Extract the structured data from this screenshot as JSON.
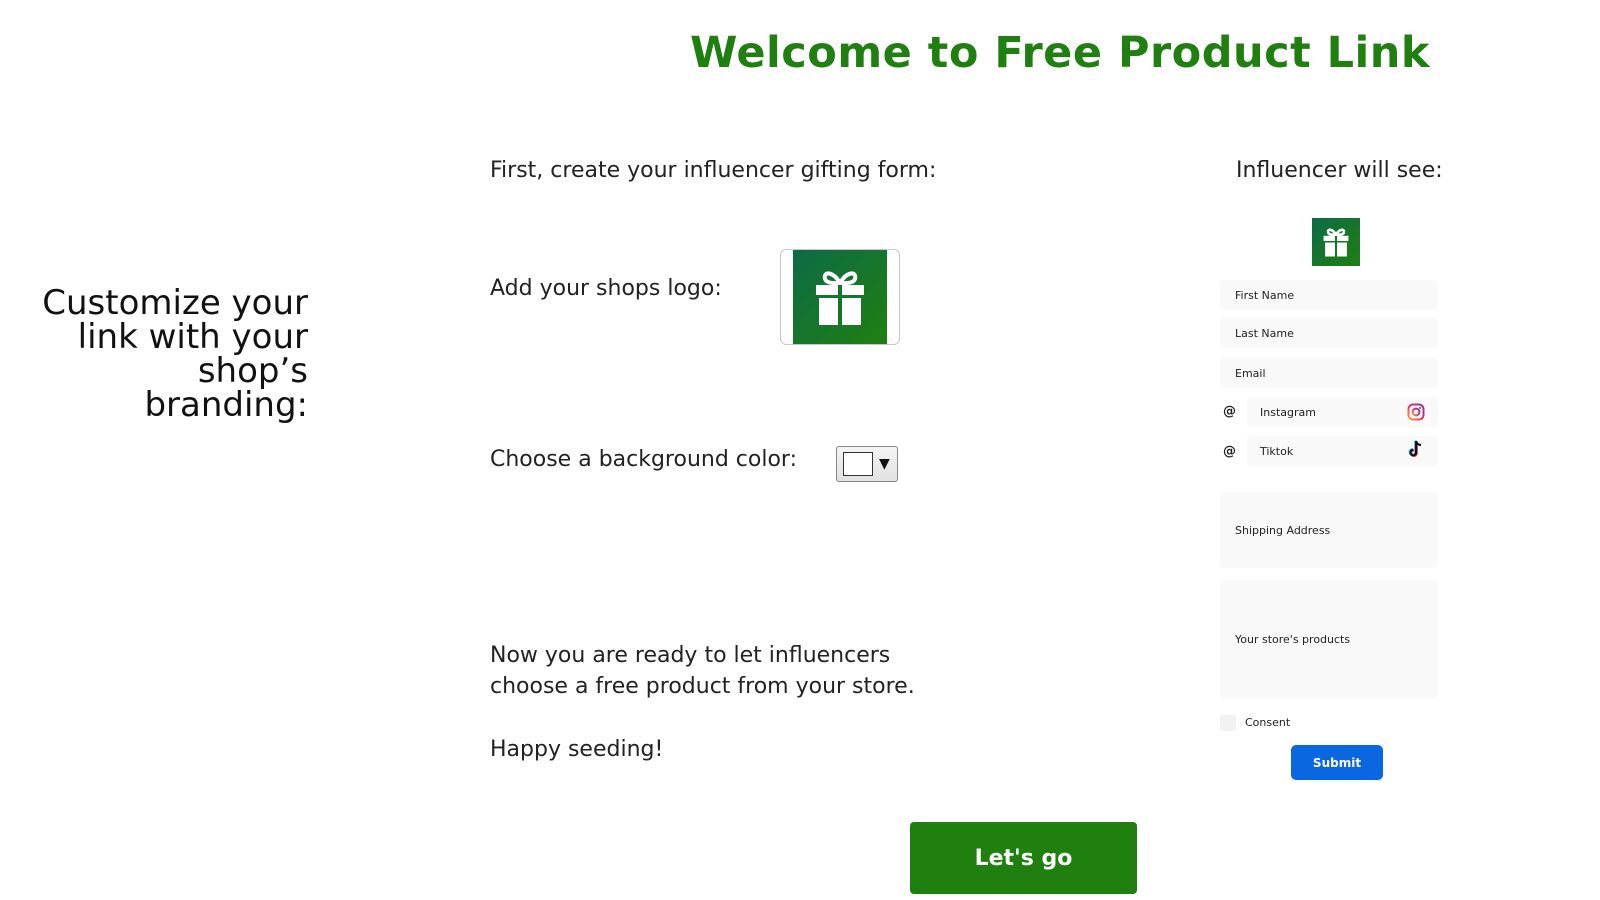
{
  "header": {
    "title": "Welcome to Free Product Link"
  },
  "sidebar": {
    "heading": "Customize your link with your shop’s branding:"
  },
  "steps": {
    "intro": "First, create your influencer gifting form:",
    "logo_label": "Add your shops logo:",
    "color_label": "Choose a background color:",
    "selected_color": "#ffffff",
    "ready_line1": "Now you are ready to let influencers",
    "ready_line2": "choose a free product from your store.",
    "closing": "Happy seeding!"
  },
  "cta": {
    "label": "Let's go"
  },
  "preview": {
    "title": "Influencer will see:",
    "fields": {
      "first_name": "First Name",
      "last_name": "Last Name",
      "email": "Email",
      "instagram": "Instagram",
      "tiktok": "Tiktok",
      "shipping": "Shipping Address",
      "products": "Your store's products"
    },
    "at_symbol": "@",
    "consent": "Consent",
    "submit": "Submit"
  },
  "colors": {
    "brand_green": "#1f7f0f",
    "logo_teal": "#0d6b47",
    "submit_blue": "#0b67e0"
  },
  "icons": [
    "gift-icon",
    "instagram-icon",
    "tiktok-icon",
    "dropdown-caret-icon"
  ]
}
